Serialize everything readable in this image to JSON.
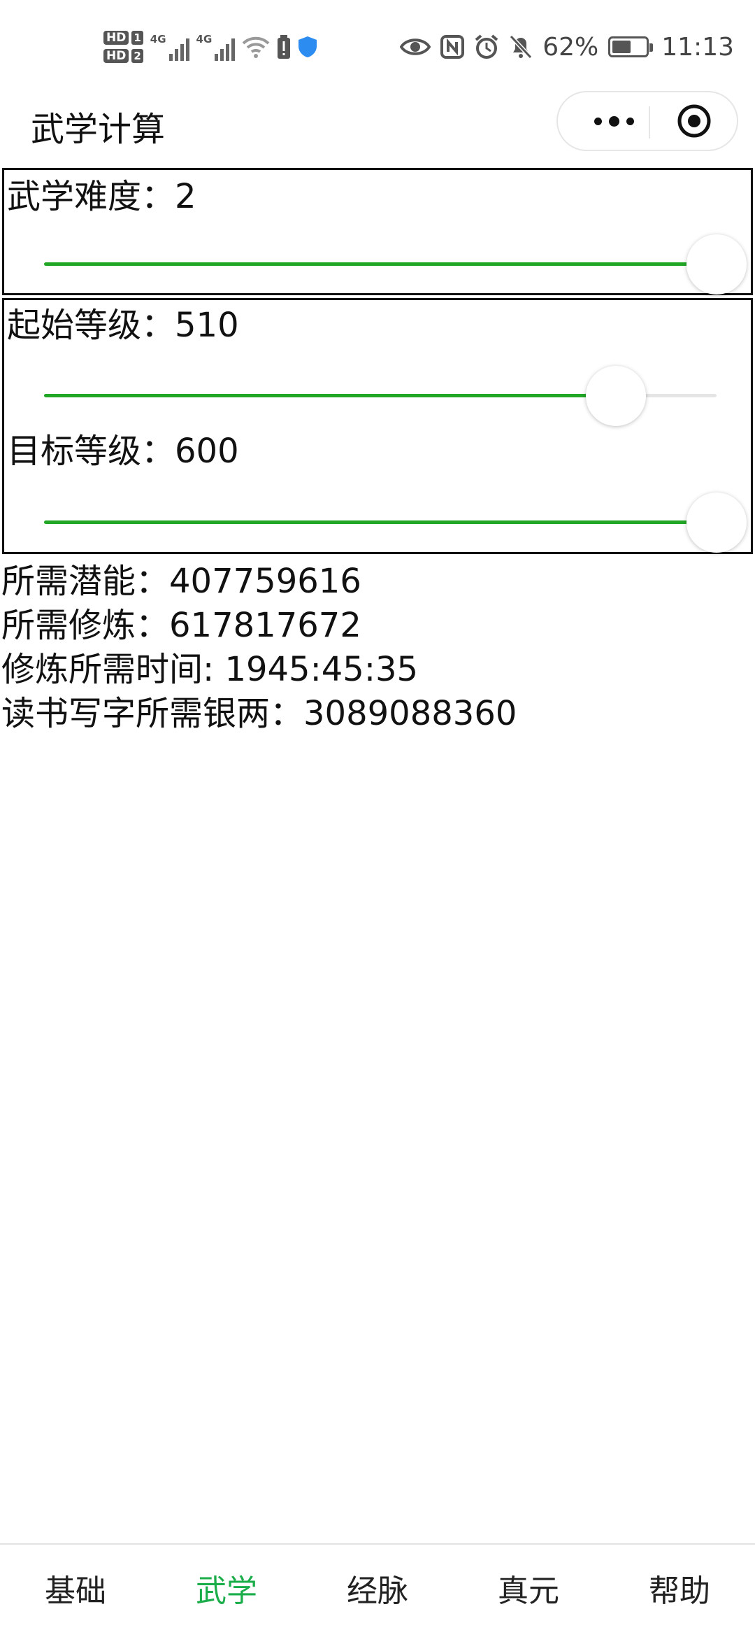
{
  "status_bar": {
    "hd1": "HD",
    "hd1_num": "1",
    "hd2": "HD",
    "hd2_num": "2",
    "net1": "4G",
    "net2": "4G",
    "battery_percent": "62%",
    "battery_level": 0.62,
    "time": "11:13",
    "icons": [
      "eye-icon",
      "nfc-icon",
      "alarm-icon",
      "mute-bell-icon",
      "wifi-icon",
      "battery-alert-icon",
      "shield-icon"
    ]
  },
  "navbar": {
    "title": "武学计算"
  },
  "difficulty": {
    "label": "武学难度：",
    "value": "2",
    "slider_fraction": 1.0
  },
  "start_level": {
    "label": "起始等级：",
    "value": "510",
    "slider_fraction": 0.85
  },
  "target_level": {
    "label": "目标等级：",
    "value": "600",
    "slider_fraction": 1.0
  },
  "results": {
    "potential_label": "所需潜能：",
    "potential_value": "407759616",
    "training_label": "所需修炼：",
    "training_value": "617817672",
    "time_label": "修炼所需时间: ",
    "time_value": "1945:45:35",
    "silver_label": "读书写字所需银两：",
    "silver_value": "3089088360"
  },
  "tabs": [
    {
      "label": "基础",
      "active": false
    },
    {
      "label": "武学",
      "active": true
    },
    {
      "label": "经脉",
      "active": false
    },
    {
      "label": "真元",
      "active": false
    },
    {
      "label": "帮助",
      "active": false
    }
  ],
  "colors": {
    "accent_green": "#22a626",
    "tab_active": "#1aad4a"
  }
}
